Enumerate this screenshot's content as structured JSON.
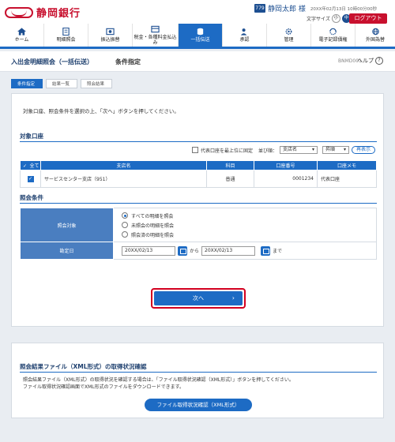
{
  "header": {
    "bank_name": "静岡銀行",
    "user_badge": "779",
    "user_name": "静岡太郎 様",
    "last_login": "20XX年02月13日 10時00分00秒",
    "font_size_label": "文字サイズ",
    "font_sizes": [
      "小",
      "中",
      "大"
    ],
    "logout_label": "ログアウト"
  },
  "nav": {
    "items": [
      {
        "label": "ホーム",
        "icon": "home-icon"
      },
      {
        "label": "明細照会",
        "icon": "document-icon"
      },
      {
        "label": "振込振替",
        "icon": "transfer-icon"
      },
      {
        "label": "税金・各種料金払込み",
        "icon": "payment-icon"
      },
      {
        "label": "一括伝送",
        "icon": "database-icon"
      },
      {
        "label": "承認",
        "icon": "user-check-icon"
      },
      {
        "label": "管理",
        "icon": "gear-icon"
      },
      {
        "label": "電子記録債権",
        "icon": "sync-icon"
      },
      {
        "label": "外国為替",
        "icon": "globe-icon"
      }
    ]
  },
  "title": {
    "main": "入出金明細照会（一括伝送）",
    "sub": "条件指定",
    "code": "BNMD001",
    "help": "ヘルプ"
  },
  "steps": [
    "条件指定",
    "結果一覧",
    "照会結果"
  ],
  "instruction": "対象口座、照会条件を選択の上、「次へ」ボタンを押してください。",
  "accounts": {
    "title": "対象口座",
    "pin_label": "代表口座を最上位に固定",
    "sort_label": "並び順：",
    "sort_value": "支店名",
    "order_value": "昇順",
    "resort_label": "再表示",
    "columns": [
      "全て",
      "支店名",
      "科目",
      "口座番号",
      "口座メモ"
    ],
    "rows": [
      {
        "branch": "サービスセンター支店（951）",
        "type": "普通",
        "number": "0001234",
        "memo": "代表口座"
      }
    ]
  },
  "conditions": {
    "title": "照会条件",
    "target_label": "照会対象",
    "options": [
      "すべての明細を照会",
      "未照会の明細を照会",
      "照会済の明細を照会"
    ],
    "date_label": "勘定日",
    "date_from": "20XX/02/13",
    "date_to": "20XX/02/13",
    "from_text": "から",
    "to_text": "まで"
  },
  "next_label": "次へ",
  "xml_section": {
    "title": "照会結果ファイル（XML形式）の取得状況確認",
    "text_line1": "照会結果ファイル（XML形式）の取得状況を確認する場合は、「ファイル取得状況確認（XML形式）」ボタンを押してください。",
    "text_line2": "ファイル取得状況確認画面でXML形式のファイルをダウンロードできます。",
    "button_label": "ファイル取得状況確認（XML形式）"
  }
}
